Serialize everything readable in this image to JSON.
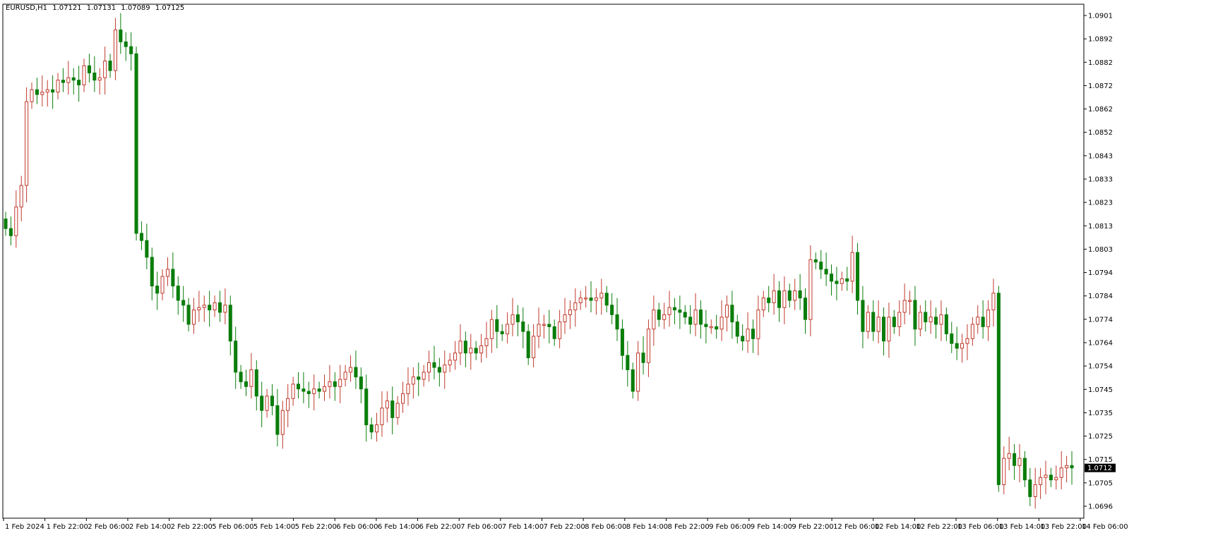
{
  "header": {
    "symbol": "EURUSD,H1",
    "open": "1.07121",
    "high": "1.07131",
    "low": "1.07089",
    "close": "1.07125"
  },
  "price_axis": {
    "labels": [
      "1.0901",
      "1.0892",
      "1.0882",
      "1.0872",
      "1.0862",
      "1.0852",
      "1.0843",
      "1.0833",
      "1.0823",
      "1.0813",
      "1.0803",
      "1.0794",
      "1.0784",
      "1.0774",
      "1.0764",
      "1.0754",
      "1.0745",
      "1.0735",
      "1.0725",
      "1.0715",
      "1.0705",
      "1.0696"
    ],
    "current_price": "1.0712"
  },
  "time_axis": {
    "labels": [
      "1 Feb 2024",
      "1 Feb 22:00",
      "2 Feb 06:00",
      "2 Feb 14:00",
      "2 Feb 22:00",
      "5 Feb 06:00",
      "5 Feb 14:00",
      "5 Feb 22:00",
      "6 Feb 06:00",
      "6 Feb 14:00",
      "6 Feb 22:00",
      "7 Feb 06:00",
      "7 Feb 14:00",
      "7 Feb 22:00",
      "8 Feb 06:00",
      "8 Feb 14:00",
      "8 Feb 22:00",
      "9 Feb 06:00",
      "9 Feb 14:00",
      "9 Feb 22:00",
      "12 Feb 06:00",
      "12 Feb 14:00",
      "12 Feb 22:00",
      "13 Feb 06:00",
      "13 Feb 14:00",
      "13 Feb 22:00",
      "14 Feb 06:00"
    ]
  },
  "colors": {
    "background": "#ffffff",
    "bull_fill": "#ffffff",
    "bull_stroke": "#c0392b",
    "bear_fill": "#0a7d0a",
    "bear_stroke": "#0a7d0a",
    "axis": "#000000",
    "price_tag_bg": "#000000",
    "price_tag_text": "#ffffff"
  },
  "chart_data": {
    "type": "candlestick",
    "symbol": "EURUSD",
    "timeframe": "H1",
    "ylim": [
      1.0696,
      1.0905
    ],
    "close_levels": [
      1.0812,
      1.0809,
      1.0821,
      1.083,
      1.0865,
      1.087,
      1.0868,
      1.0869,
      1.087,
      1.0869,
      1.0874,
      1.0873,
      1.0875,
      1.0874,
      1.0872,
      1.088,
      1.0877,
      1.0874,
      1.0875,
      1.0882,
      1.0878,
      1.0895,
      1.089,
      1.0888,
      1.0885,
      1.081,
      1.0807,
      1.08,
      1.0788,
      1.0785,
      1.0792,
      1.0795,
      1.0788,
      1.0782,
      1.078,
      1.0772,
      1.0778,
      1.0779,
      1.078,
      1.0778,
      1.0781,
      1.0777,
      1.078,
      1.0765,
      1.0752,
      1.0748,
      1.0746,
      1.0753,
      1.0742,
      1.0736,
      1.0742,
      1.0738,
      1.0726,
      1.0736,
      1.0741,
      1.0747,
      1.0745,
      1.0744,
      1.0743,
      1.0745,
      1.0744,
      1.0746,
      1.0748,
      1.0746,
      1.0749,
      1.0752,
      1.0754,
      1.075,
      1.0745,
      1.073,
      1.0727,
      1.073,
      1.0737,
      1.074,
      1.0733,
      1.0739,
      1.0743,
      1.0747,
      1.075,
      1.0749,
      1.0752,
      1.0756,
      1.0754,
      1.0752,
      1.0755,
      1.0757,
      1.076,
      1.0765,
      1.076,
      1.0762,
      1.076,
      1.0763,
      1.0766,
      1.0774,
      1.0769,
      1.0768,
      1.0772,
      1.0776,
      1.0773,
      1.0769,
      1.0758,
      1.0767,
      1.0772,
      1.0772,
      1.0771,
      1.0766,
      1.0773,
      1.0776,
      1.0778,
      1.0781,
      1.0783,
      1.0783,
      1.0782,
      1.0783,
      1.0785,
      1.078,
      1.0776,
      1.077,
      1.0759,
      1.0753,
      1.0744,
      1.076,
      1.0756,
      1.077,
      1.0778,
      1.0774,
      1.0776,
      1.0779,
      1.0778,
      1.0777,
      1.0775,
      1.0772,
      1.0778,
      1.0772,
      1.0771,
      1.0771,
      1.077,
      1.0775,
      1.078,
      1.0773,
      1.0767,
      1.0765,
      1.077,
      1.0766,
      1.0778,
      1.0783,
      1.0781,
      1.0786,
      1.0779,
      1.0786,
      1.0782,
      1.0786,
      1.0783,
      1.0774,
      1.0799,
      1.0798,
      1.0795,
      1.0793,
      1.079,
      1.0789,
      1.0791,
      1.079,
      1.0802,
      1.0782,
      1.0769,
      1.0777,
      1.0769,
      1.0775,
      1.0765,
      1.0775,
      1.0771,
      1.0777,
      1.0782,
      1.0782,
      1.077,
      1.0777,
      1.0773,
      1.0775,
      1.0772,
      1.0776,
      1.0768,
      1.0764,
      1.0762,
      1.0764,
      1.0766,
      1.0772,
      1.0775,
      1.0771,
      1.0778,
      1.0785,
      1.0705,
      1.0716,
      1.0718,
      1.0713,
      1.0716,
      1.0707,
      1.07,
      1.0705,
      1.0708,
      1.0709,
      1.0707,
      1.0708,
      1.0712,
      1.0713,
      1.0712
    ]
  }
}
